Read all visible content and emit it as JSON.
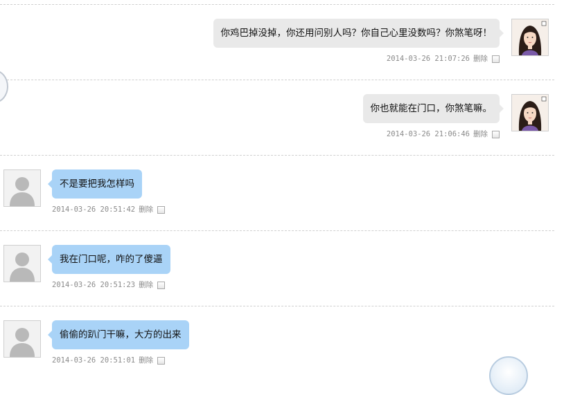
{
  "messages": [
    {
      "side": "sent",
      "text": "你鸡巴掉没掉，你还用问别人吗？你自己心里没数吗？你煞笔呀！",
      "timestamp": "2014-03-26 21:07:26",
      "delete_label": "删除",
      "avatar_icon": "female-portrait-icon"
    },
    {
      "side": "sent",
      "text": "你也就能在门口，你煞笔嘛。",
      "timestamp": "2014-03-26 21:06:46",
      "delete_label": "删除",
      "avatar_icon": "female-portrait-icon"
    },
    {
      "side": "received",
      "text": "不是要把我怎样吗",
      "timestamp": "2014-03-26 20:51:42",
      "delete_label": "删除",
      "avatar_icon": "default-user-icon"
    },
    {
      "side": "received",
      "text": "我在门口呢，咋的了傻逼",
      "timestamp": "2014-03-26 20:51:23",
      "delete_label": "删除",
      "avatar_icon": "default-user-icon"
    },
    {
      "side": "received",
      "text": "偷偷的趴门干嘛，大方的出来",
      "timestamp": "2014-03-26 20:51:01",
      "delete_label": "删除",
      "avatar_icon": "default-user-icon"
    }
  ],
  "colors": {
    "sent_bubble": "#e9e9e9",
    "received_bubble": "#a9d3f7",
    "meta_text": "#8a8a8a",
    "divider": "#cfcfcf"
  }
}
